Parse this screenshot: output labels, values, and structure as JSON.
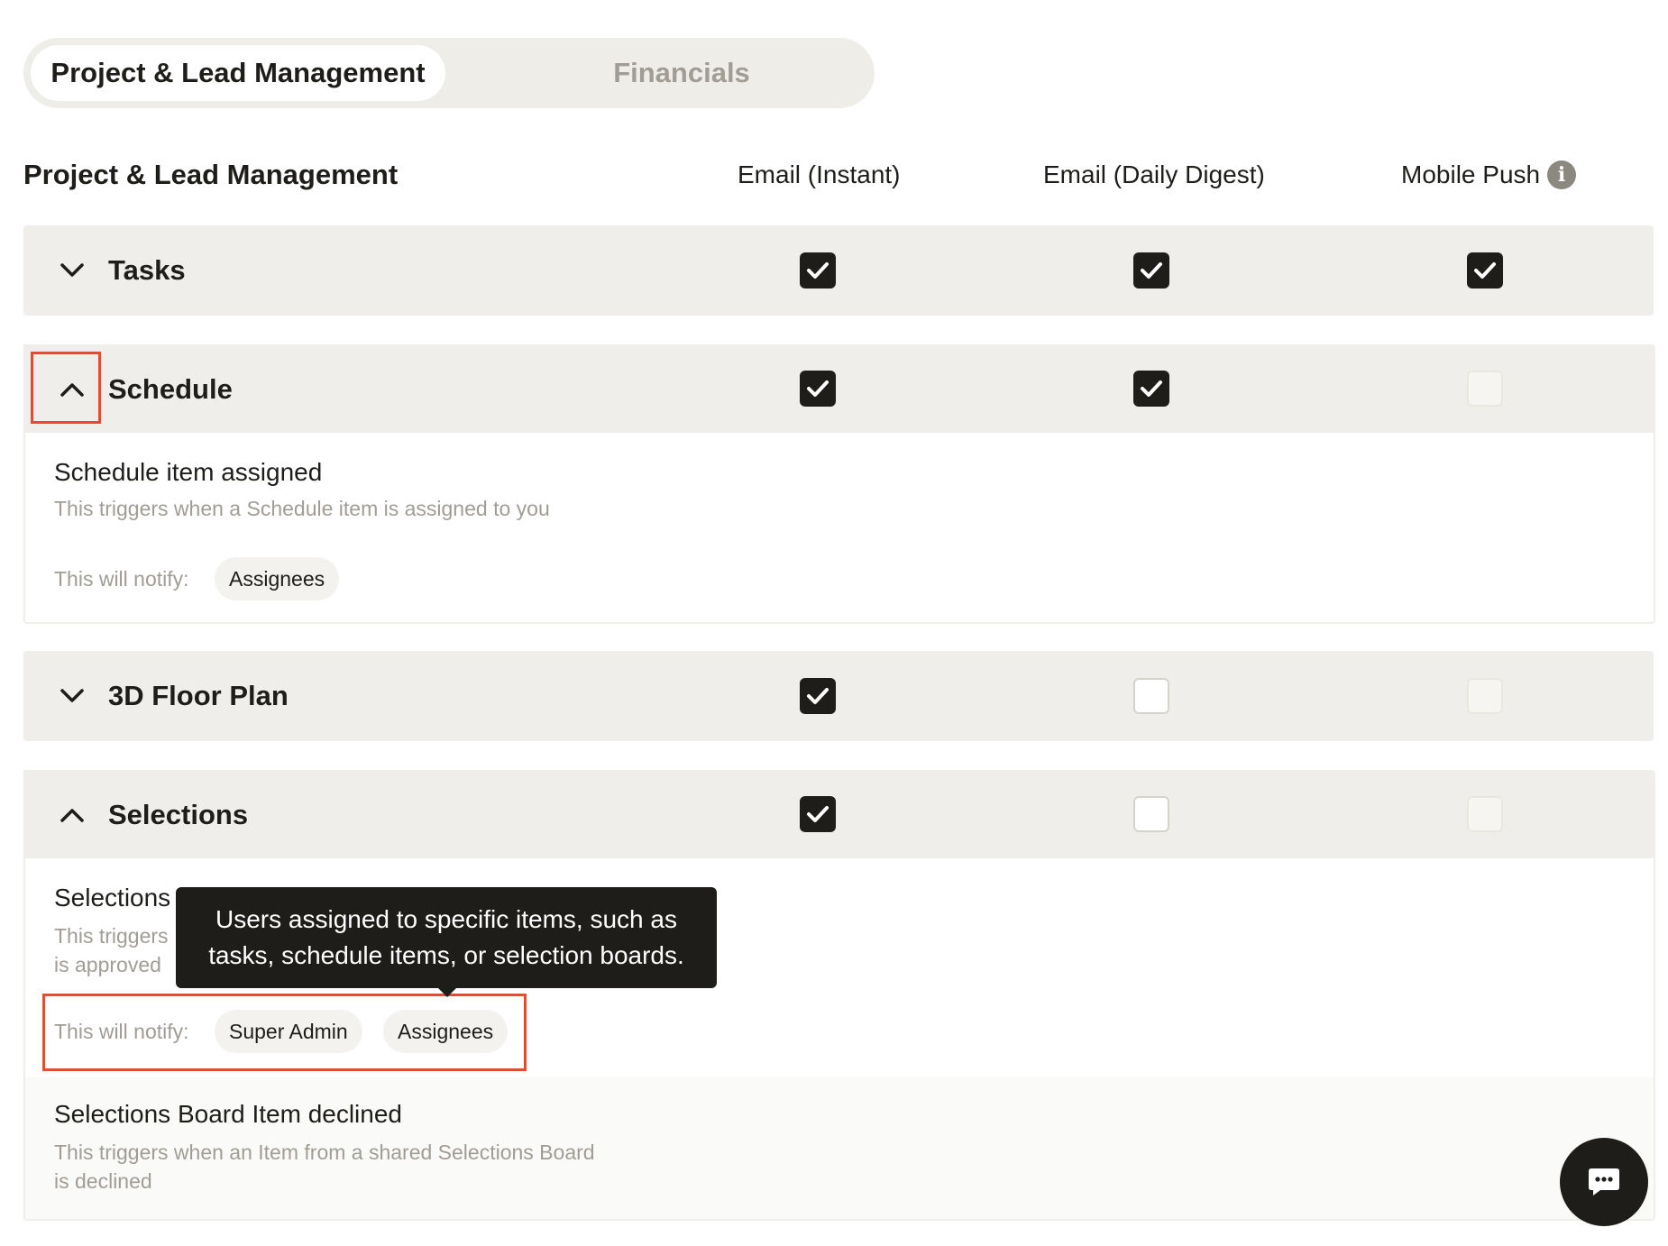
{
  "tabs": [
    {
      "label": "Project & Lead Management",
      "active": true
    },
    {
      "label": "Financials",
      "active": false
    }
  ],
  "header": {
    "title": "Project & Lead Management",
    "columns": [
      "Email (Instant)",
      "Email (Daily Digest)",
      "Mobile Push"
    ]
  },
  "categories": [
    {
      "label": "Tasks",
      "expanded": false,
      "email_instant": "checked",
      "email_digest": "checked",
      "mobile_push": "checked"
    },
    {
      "label": "Schedule",
      "expanded": true,
      "email_instant": "checked",
      "email_digest": "checked",
      "mobile_push": "disabled",
      "items": [
        {
          "title": "Schedule item assigned",
          "description": "This triggers when a Schedule item is assigned to you",
          "notify_label": "This will notify:",
          "recipients": [
            "Assignees"
          ]
        }
      ]
    },
    {
      "label": "3D Floor Plan",
      "expanded": false,
      "email_instant": "checked",
      "email_digest": "unchecked",
      "mobile_push": "disabled"
    },
    {
      "label": "Selections",
      "expanded": true,
      "email_instant": "checked",
      "email_digest": "unchecked",
      "mobile_push": "disabled",
      "items": [
        {
          "title": "Selections",
          "description_line1": "This triggers",
          "description_line2": "is approved",
          "notify_label": "This will notify:",
          "recipients": [
            "Super Admin",
            "Assignees"
          ]
        },
        {
          "title": "Selections Board Item declined",
          "description_line1": "This triggers when an Item from a shared Selections Board",
          "description_line2": "is declined"
        }
      ]
    }
  ],
  "tooltip": {
    "line1": "Users assigned to specific items, such as",
    "line2": "tasks, schedule items, or selection boards."
  },
  "icons": {
    "info": "info-icon",
    "chat": "chat-icon",
    "expand": "chevron-down-icon",
    "collapse": "chevron-up-icon",
    "check": "check-icon"
  },
  "colors": {
    "accent_dark": "#1f1d1a",
    "row_bg": "#efeeea",
    "muted_text": "#a19d95",
    "highlight_red": "#e54b30"
  }
}
